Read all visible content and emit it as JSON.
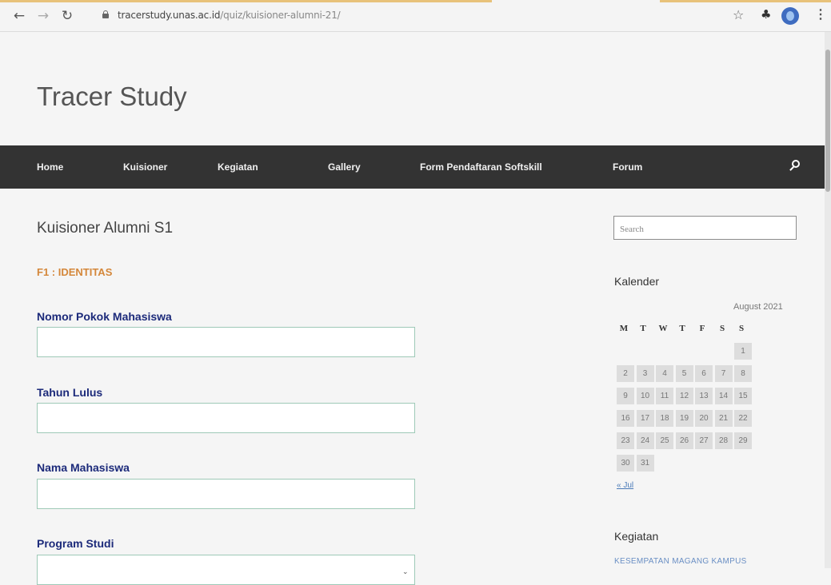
{
  "browser": {
    "url_domain": "tracerstudy.unas.ac.id",
    "url_path": "/quiz/kuisioner-alumni-21/"
  },
  "site": {
    "title": "Tracer Study"
  },
  "nav": {
    "items": [
      "Home",
      "Kuisioner",
      "Kegiatan",
      "Gallery",
      "Form Pendaftaran Softskill",
      "Forum"
    ]
  },
  "main": {
    "heading": "Kuisioner Alumni S1",
    "section": "F1 : IDENTITAS",
    "fields": [
      {
        "label": "Nomor Pokok Mahasiswa",
        "value": ""
      },
      {
        "label": "Tahun Lulus",
        "value": ""
      },
      {
        "label": "Nama Mahasiswa",
        "value": ""
      },
      {
        "label": "Program Studi",
        "value": ""
      }
    ]
  },
  "sidebar": {
    "search_placeholder": "Search",
    "calendar_title": "Kalender",
    "calendar_caption": "August 2021",
    "weekdays": [
      "M",
      "T",
      "W",
      "T",
      "F",
      "S",
      "S"
    ],
    "calendar_days": [
      "1",
      "2",
      "3",
      "4",
      "5",
      "6",
      "7",
      "8",
      "9",
      "10",
      "11",
      "12",
      "13",
      "14",
      "15",
      "16",
      "17",
      "18",
      "19",
      "20",
      "21",
      "22",
      "23",
      "24",
      "25",
      "26",
      "27",
      "28",
      "29",
      "30",
      "31"
    ],
    "prev_link": "« Jul",
    "activities_title": "Kegiatan",
    "activity_link": "KESEMPATAN MAGANG KAMPUS"
  }
}
